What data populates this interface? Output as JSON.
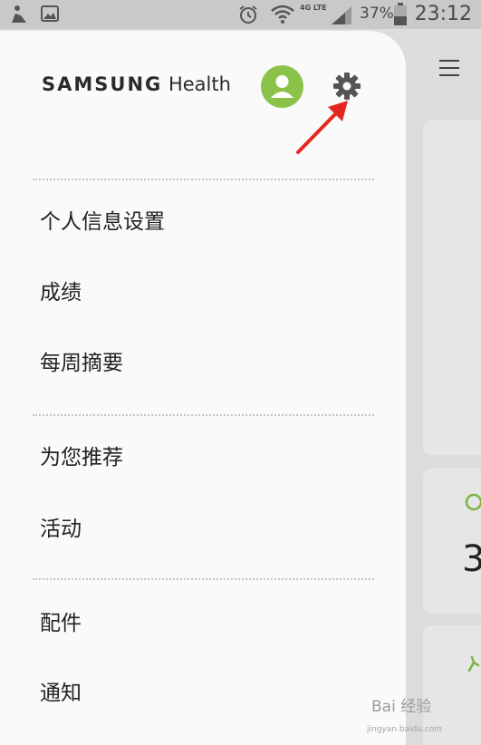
{
  "status_bar": {
    "network_type": "4G LTE",
    "battery_percent": "37%",
    "time": "23:12"
  },
  "drawer": {
    "brand_samsung": "SAMSUNG",
    "brand_health": "Health",
    "menu_sections": [
      {
        "items": [
          "个人信息设置",
          "成绩",
          "每周摘要"
        ]
      },
      {
        "items": [
          "为您推荐",
          "活动"
        ]
      },
      {
        "items": [
          "配件",
          "通知"
        ]
      }
    ]
  },
  "background": {
    "card_number": "3"
  },
  "watermark": {
    "text": "Bai 经验",
    "sub": "jingyan.baidu.com"
  }
}
